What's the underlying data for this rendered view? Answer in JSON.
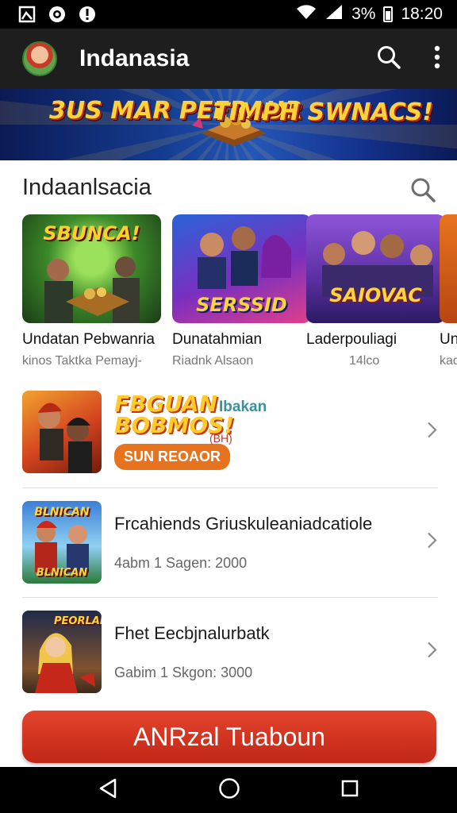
{
  "status_bar": {
    "battery_text": "3%",
    "time": "18:20"
  },
  "app_bar": {
    "title": "Indanasia",
    "icons": [
      "search-icon",
      "more-vert-icon"
    ]
  },
  "banner": {
    "left_text": "3US MAR PEERAUR",
    "right_text": "TIMPH SWNACS!"
  },
  "section": {
    "title": "Indaanlsacia",
    "cards": [
      {
        "thumb_text": "SBUNCA!",
        "title": "Undatan Pebwanria",
        "subtitle": "kinos Taktka Pemayj-"
      },
      {
        "thumb_text": "SERSSID",
        "title": "Dunatahmian",
        "subtitle": "Riadnk Alsaon"
      },
      {
        "thumb_text": "SAIOVAC",
        "title": "Laderpouliagi",
        "subtitle": "14lco"
      },
      {
        "thumb_text": "",
        "title": "Un",
        "subtitle": "kad"
      }
    ]
  },
  "promo": {
    "title": "FBGUAN BOBMOS!",
    "side_label": "Ibakan",
    "badge": "(BH)",
    "tag": "SUN REOAOR"
  },
  "list": [
    {
      "thumb_text": "BLNICAN",
      "title": "Frcahiends Griuskuleaniadcatiole",
      "meta": "4abm 1 Sagen: 2000"
    },
    {
      "thumb_text": "PEORLAN",
      "title": "Fhet Eecbjnalurbatk",
      "meta": "Gabim 1 Skgon: 3000"
    }
  ],
  "cta": {
    "label": "ANRzal Tuaboun"
  },
  "colors": {
    "accent": "#d7331f",
    "app_bar": "#1e1e1e",
    "banner_text": "#ffd23a"
  }
}
